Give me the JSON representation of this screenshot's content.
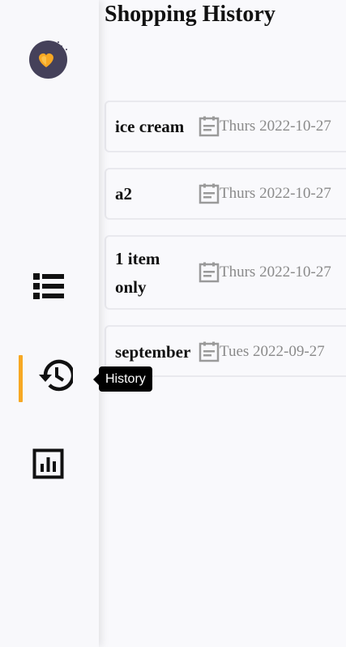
{
  "page": {
    "title": "Shopping History"
  },
  "sidebar": {
    "logo_icon": "heart-cart-logo",
    "items": [
      {
        "name": "list",
        "icon": "list-icon"
      },
      {
        "name": "history",
        "icon": "history-icon",
        "active": true
      },
      {
        "name": "statistics",
        "icon": "chart-icon"
      }
    ],
    "tooltip": "History",
    "accent_color": "#f7a823"
  },
  "lists": [
    {
      "name": "ice cream",
      "date": "Thurs 2022-10-27"
    },
    {
      "name": "a2",
      "date": "Thurs 2022-10-27"
    },
    {
      "name": "1 item only",
      "date": "Thurs 2022-10-27"
    },
    {
      "name": "september",
      "date": "Tues 2022-09-27"
    }
  ]
}
